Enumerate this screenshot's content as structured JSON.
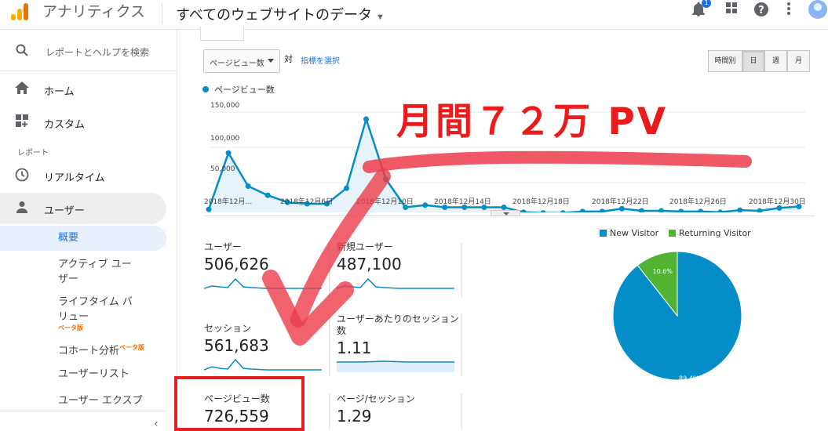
{
  "topbar": {
    "app_name": "アナリティクス",
    "account_line": "",
    "property_title": "すべてのウェブサイトのデータ",
    "notification_count": "1",
    "icons": [
      "bell-icon",
      "apps-icon",
      "help-icon",
      "more-vert-icon",
      "avatar"
    ]
  },
  "sidebar": {
    "search_label": "レポートとヘルプを検索",
    "home_label": "ホーム",
    "custom_label": "カスタム",
    "section_label": "レポート",
    "realtime_label": "リアルタイム",
    "users_label": "ユーザー",
    "sub_items": {
      "overview": "概要",
      "active_users_1": "アクティブ ユー",
      "active_users_2": "ザー",
      "lifetime_1": "ライフタイム バ",
      "lifetime_2": "リュー",
      "lifetime_beta": "ベータ版",
      "cohort": "コホート分析",
      "cohort_beta": "ベータ版",
      "user_list": "ユーザーリスト",
      "user_explorer": "ユーザー エクスプ"
    }
  },
  "controls": {
    "metric_dropdown": "ページビュー数",
    "vs_label": "対",
    "pick_metric": "指標を選択",
    "segments": [
      "時間別",
      "日",
      "週",
      "月"
    ],
    "active_segment": "日"
  },
  "chart_data": {
    "type": "line",
    "series": [
      {
        "name": "ページビュー数",
        "values": [
          12000,
          92000,
          45000,
          32000,
          22000,
          20000,
          20000,
          42000,
          140000,
          55000,
          15000,
          18000,
          15000,
          15000,
          15000,
          15000,
          8000,
          7000,
          7000,
          9000,
          9000,
          13000,
          10000,
          10000,
          9000,
          9000,
          8000,
          11000,
          10000,
          14000,
          16000
        ]
      }
    ],
    "x": [
      "12/1",
      "12/2",
      "12/3",
      "12/4",
      "12/5",
      "12/6",
      "12/7",
      "12/8",
      "12/9",
      "12/10",
      "12/11",
      "12/12",
      "12/13",
      "12/14",
      "12/15",
      "12/16",
      "12/17",
      "12/18",
      "12/19",
      "12/20",
      "12/21",
      "12/22",
      "12/23",
      "12/24",
      "12/25",
      "12/26",
      "12/27",
      "12/28",
      "12/29",
      "12/30",
      "12/31"
    ],
    "ylim": [
      0,
      160000
    ],
    "yticks": [
      "150,000",
      "100,000",
      "50,000"
    ],
    "xticks": [
      "2018年12月…",
      "2018年12月6日",
      "2018年12月10日",
      "2018年12月14日",
      "2018年12月18日",
      "2018年12月22日",
      "2018年12月26日",
      "2018年12月30日"
    ],
    "color": "#058dc7",
    "grid": true
  },
  "metrics": {
    "users": {
      "name": "ユーザー",
      "value": "506,626"
    },
    "new_users": {
      "name": "新規ユーザー",
      "value": "487,100"
    },
    "sessions": {
      "name": "セッション",
      "value": "561,683"
    },
    "sessions_per_user": {
      "name": "ユーザーあたりのセッション数",
      "value": "1.11"
    },
    "pageviews": {
      "name": "ページビュー数",
      "value": "726,559"
    },
    "pages_per_session": {
      "name": "ページ/セッション",
      "value": "1.29"
    }
  },
  "pie_chart": {
    "type": "pie",
    "slices": [
      {
        "name": "New Visitor",
        "value": 89.4,
        "label": "89.4%",
        "color": "#058dc7"
      },
      {
        "name": "Returning Visitor",
        "value": 10.6,
        "label": "10.6%",
        "color": "#50b432"
      }
    ]
  },
  "annotation": {
    "text": "月間７２万 PV",
    "color": "#ec1a1a"
  }
}
